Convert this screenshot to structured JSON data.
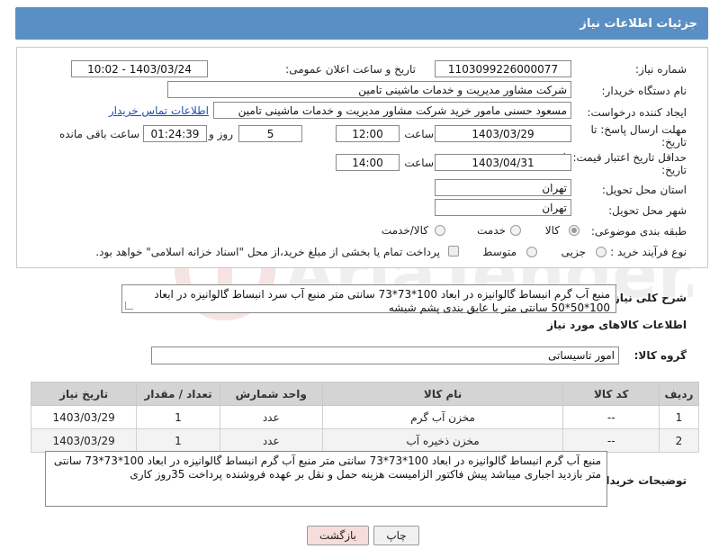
{
  "header": {
    "title": "جزئیات اطلاعات نیاز"
  },
  "form": {
    "need_number_label": "شماره نیاز:",
    "need_number": "1103099226000077",
    "announce_label": "تاریخ و ساعت اعلان عمومی:",
    "announce_value": "1403/03/24 - 10:02",
    "buyer_org_label": "نام دستگاه خریدار:",
    "buyer_org": "شرکت مشاور مدیریت و خدمات ماشینی تامین",
    "creator_label": "ایجاد کننده درخواست:",
    "creator": "مسعود حسنی مامور خرید شرکت مشاور مدیریت و خدمات ماشینی تامین",
    "contact_link": "اطلاعات تماس خریدار",
    "deadline_label_1": "مهلت ارسال پاسخ: تا",
    "deadline_label_2": "تاریخ:",
    "deadline_date": "1403/03/29",
    "time_label": "ساعت",
    "deadline_time": "12:00",
    "days_value": "5",
    "days_label": "روز و",
    "remaining_value": "01:24:39",
    "remaining_label": "ساعت باقی مانده",
    "validity_label_1": "حداقل تاریخ اعتبار قیمت: تا",
    "validity_label_2": "تاریخ:",
    "validity_date": "1403/04/31",
    "validity_time": "14:00",
    "province_label": "استان محل تحویل:",
    "province": "تهران",
    "city_label": "شهر محل تحویل:",
    "city": "تهران",
    "category_label": "طبقه بندی موضوعی:",
    "category_options": [
      "کالا",
      "خدمت",
      "کالا/خدمت"
    ],
    "process_label": "نوع فرآیند خرید :",
    "process_options": [
      "جزیی",
      "متوسط"
    ],
    "payment_note": "پرداخت تمام یا بخشی از مبلغ خرید،از محل \"اسناد خزانه اسلامی\" خواهد بود."
  },
  "summary": {
    "label": "شرح کلی نیاز:",
    "text": "منبع آب گرم انبساط   گالوانیزه در ابعاد 100*73*73 سانتی متر منبع آب سرد انبساط  گالوانیزه در ابعاد 100*50*50 سانتی متر  با عایق بندی  پشم شیشه"
  },
  "goods": {
    "section_title": "اطلاعات کالاهای مورد نیاز",
    "group_label": "گروه کالا:",
    "group_value": "امور تاسیساتی",
    "columns": [
      "ردیف",
      "کد کالا",
      "نام کالا",
      "واحد شمارش",
      "تعداد / مقدار",
      "تاریخ نیاز"
    ],
    "rows": [
      [
        "1",
        "--",
        "مخزن آب گرم",
        "عدد",
        "1",
        "1403/03/29"
      ],
      [
        "2",
        "--",
        "مخزن ذخیره آب",
        "عدد",
        "1",
        "1403/03/29"
      ]
    ]
  },
  "buyer_notes": {
    "label": "توضیحات خریدار:",
    "text": "منبع آب گرم انبساط   گالوانیزه در ابعاد 100*73*73 سانتی متر    منبع آب گرم انبساط   گالوانیزه در ابعاد 100*73*73 سانتی متر  بازدید اجباری میباشد  پیش فاکتور الزامیست هزینه حمل و نقل بر عهده فروشنده  پرداخت 35روز کاری"
  },
  "buttons": {
    "print": "چاپ",
    "back": "بازگشت"
  },
  "watermark": "AriaTender.net",
  "colors": {
    "header_bg": "#5a8fc6",
    "back_button_bg": "#f7dcdc",
    "link": "#1a4fb5"
  }
}
